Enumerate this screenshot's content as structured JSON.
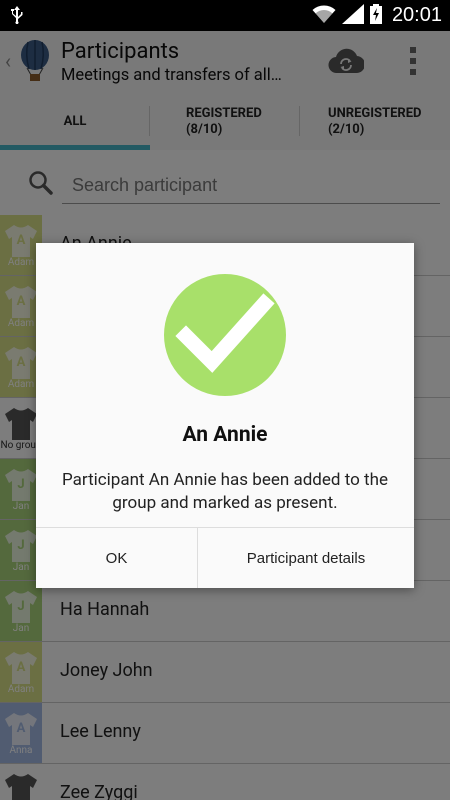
{
  "status_bar": {
    "time": "20:01"
  },
  "action_bar": {
    "title": "Participants",
    "subtitle": "Meetings and transfers of all…"
  },
  "tabs": [
    {
      "label": "ALL"
    },
    {
      "label": "REGISTERED\n(8/10)"
    },
    {
      "label": "UNREGISTERED\n(2/10)"
    }
  ],
  "search": {
    "placeholder": "Search participant"
  },
  "participants": [
    {
      "name": "An Annie",
      "group_letter": "A",
      "group": "Adam"
    },
    {
      "name": "",
      "group_letter": "A",
      "group": "Adam"
    },
    {
      "name": "",
      "group_letter": "A",
      "group": "Adam"
    },
    {
      "name": "",
      "group_letter": "",
      "group": "No group"
    },
    {
      "name": "",
      "group_letter": "J",
      "group": "Jan"
    },
    {
      "name": "",
      "group_letter": "J",
      "group": "Jan"
    },
    {
      "name": "Ha Hannah",
      "group_letter": "J",
      "group": "Jan"
    },
    {
      "name": "Joney John",
      "group_letter": "A",
      "group": "Adam"
    },
    {
      "name": "Lee Lenny",
      "group_letter": "A",
      "group": "Anna"
    },
    {
      "name": "Zee Zyggi",
      "group_letter": "",
      "group": ""
    }
  ],
  "dialog": {
    "title": "An Annie",
    "message": "Participant An Annie has been added to the group and marked as present.",
    "ok_label": "OK",
    "details_label": "Participant details"
  },
  "colors": {
    "accent": "#47b4c6",
    "check_green": "#a8e06a",
    "group_adam": "#d6df86",
    "group_jan": "#a9d27a",
    "group_anna": "#a3b9e3",
    "group_none": "#4a4a4a"
  }
}
